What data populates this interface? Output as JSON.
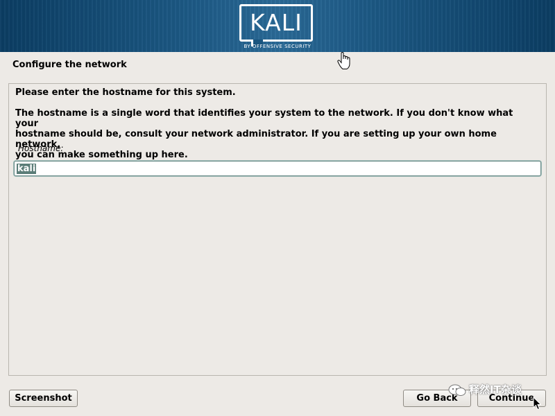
{
  "banner": {
    "logo_text": "KALI",
    "logo_subtitle": "BY OFFENSIVE SECURITY"
  },
  "page": {
    "title": "Configure the network"
  },
  "dialog": {
    "prompt": "Please enter the hostname for this system.",
    "description": "The hostname is a single word that identifies your system to the network. If you don't know what your\nhostname should be, consult your network administrator. If you are setting up your own home network,\nyou can make something up here.",
    "field_label": "Hostname:",
    "hostname_value": "kali"
  },
  "buttons": {
    "screenshot": "Screenshot",
    "go_back": "Go Back",
    "continue": "Continue"
  },
  "watermark": {
    "text": "释然IT杂谈"
  },
  "colors": {
    "banner": "#1d5a86",
    "background": "#edeae6",
    "selection": "#5b7d78"
  }
}
